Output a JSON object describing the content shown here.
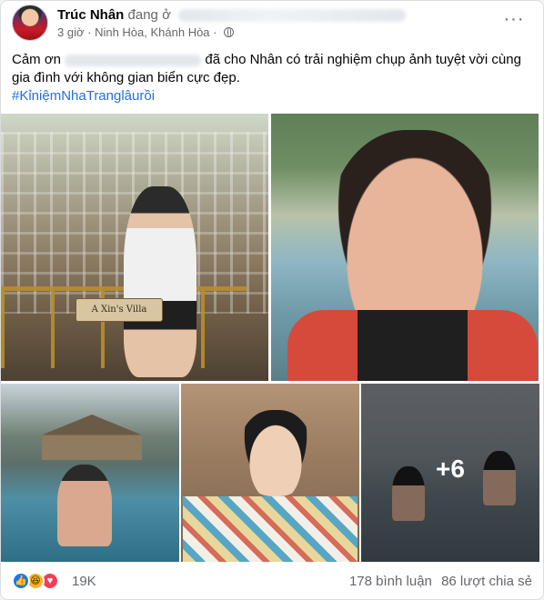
{
  "post": {
    "author_name": "Trúc Nhân",
    "author_action": "đang ở",
    "time": "3 giờ",
    "location": "· Ninh Hòa, Khánh Hòa ·",
    "text_start": "Cảm ơn",
    "text_rest": "đã cho Nhân có trải nghiệm chụp ảnh tuyệt vời cùng gia đình với không gian biển cực đẹp.",
    "hashtag": "#KỉniệmNhaTranglâurồi",
    "more_button": "···"
  },
  "photos": {
    "sign_text": "A Xin's Villa",
    "more_count": "+6"
  },
  "footer": {
    "reaction_count": "19K",
    "comments": "178 bình luận",
    "shares": "86 lượt chia sẻ",
    "like_glyph": "👍",
    "haha_glyph": "😆",
    "love_glyph": "♥"
  },
  "icons": [
    "avatar",
    "globe-icon",
    "more-icon",
    "like-icon",
    "haha-icon",
    "love-icon"
  ],
  "colors": {
    "hashtag": "#216fdb",
    "like": "#1877f2",
    "love": "#f33e58",
    "haha": "#f7b125",
    "secondary_text": "#65676b"
  }
}
